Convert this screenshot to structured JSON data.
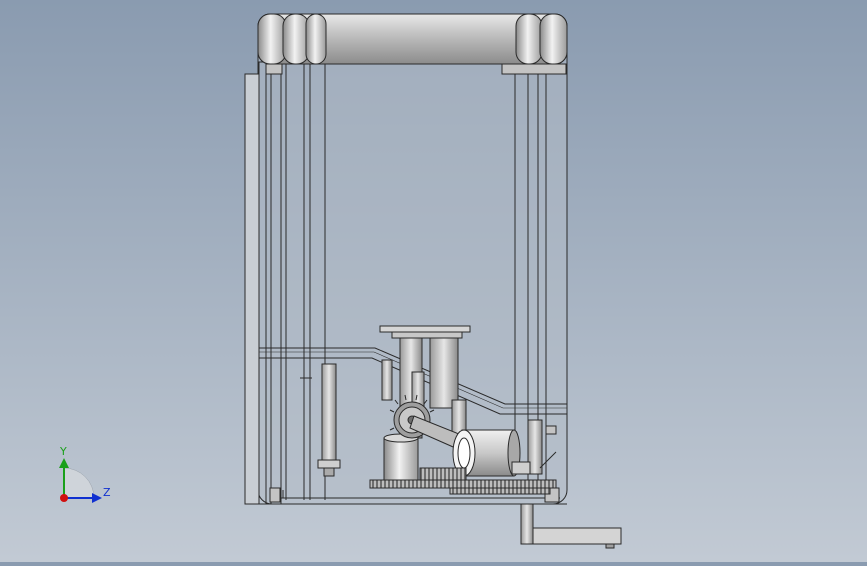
{
  "viewport": {
    "background_top": "#8a9bb0",
    "background_bottom": "#c2cad4"
  },
  "model": {
    "body_fill": "#b3bcc7",
    "frame_stroke": "#2a2a2a",
    "metal_light": "#e0e0e0",
    "metal_dark": "#7d7d7d"
  },
  "triad": {
    "y_label": "Y",
    "z_label": "Z",
    "y_color": "#1aa01a",
    "z_color": "#1030d0",
    "x_color": "#d01010"
  }
}
